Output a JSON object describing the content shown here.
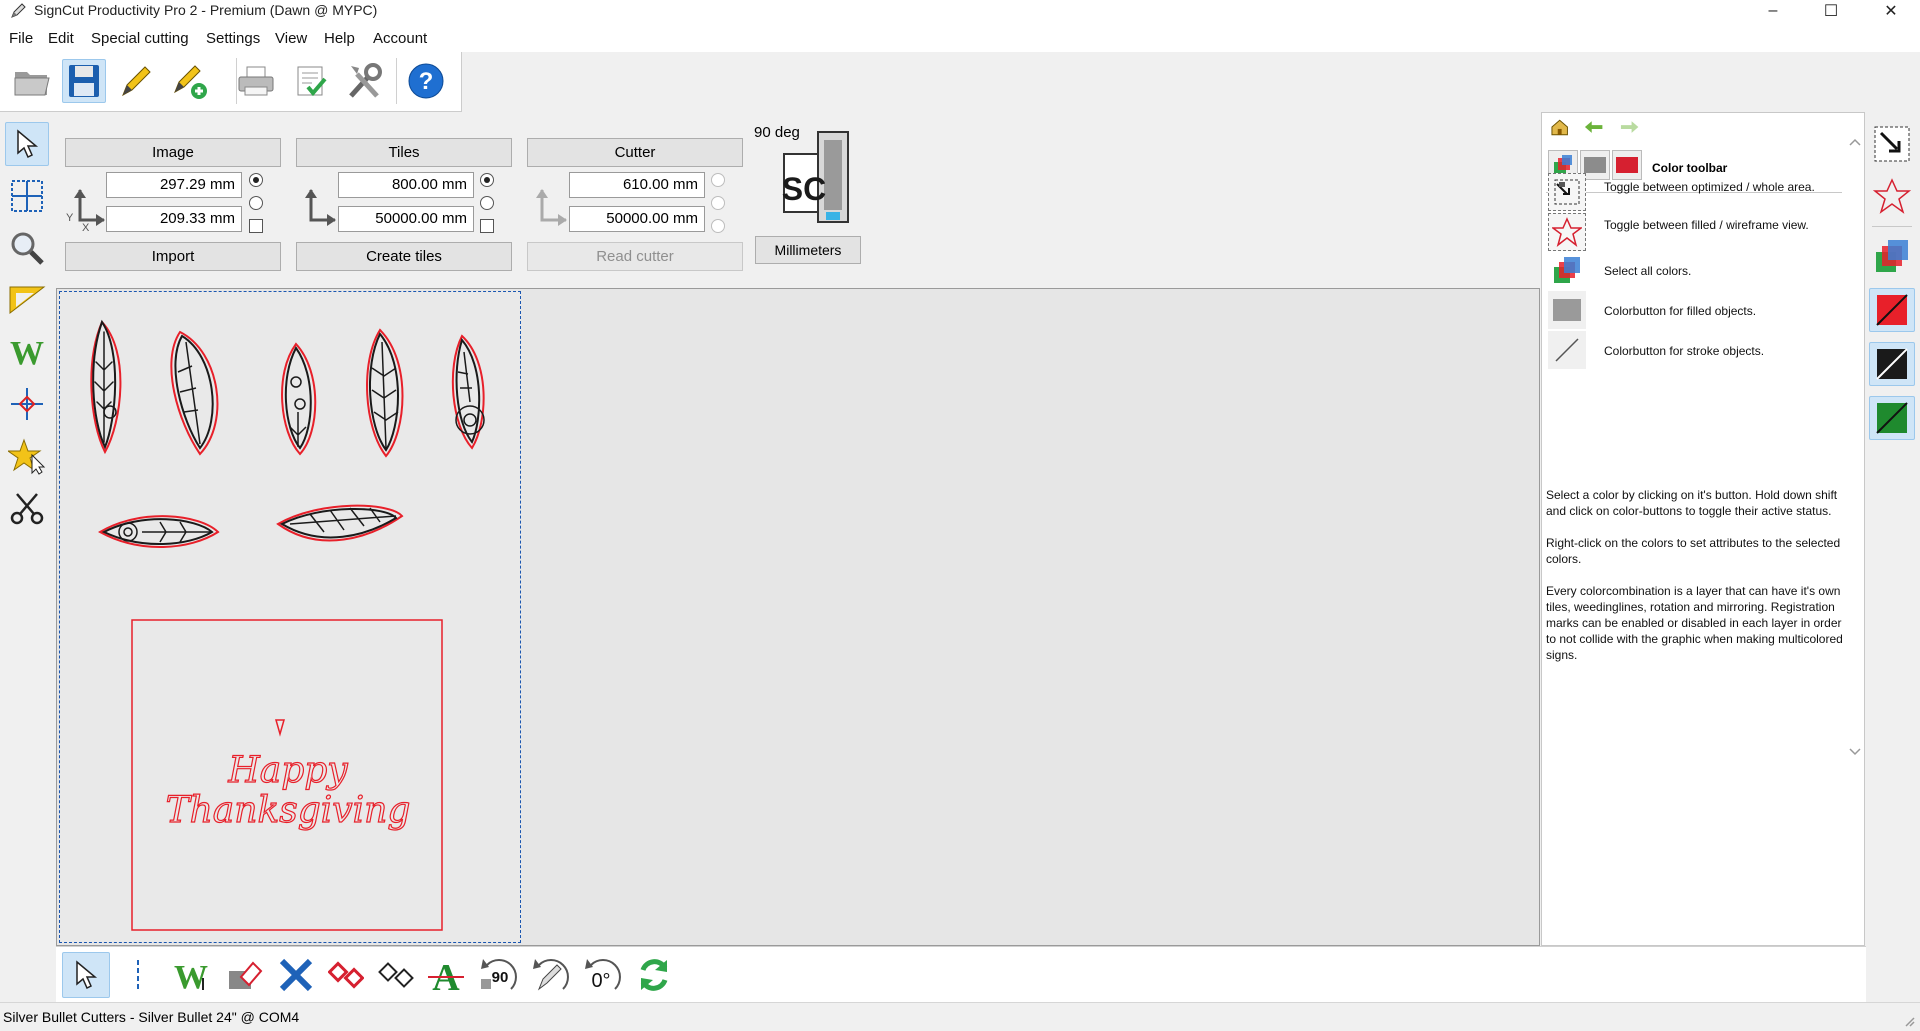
{
  "window": {
    "title": "SignCut Productivity Pro 2 - Premium (Dawn @ MYPC)",
    "minimize": "–",
    "maximize": "☐",
    "close": "✕"
  },
  "menu": [
    "File",
    "Edit",
    "Special cutting",
    "Settings",
    "View",
    "Help",
    "Account"
  ],
  "toolbar": [
    {
      "icon": "open-folder-icon"
    },
    {
      "icon": "save-icon"
    },
    {
      "icon": "pencil-edit-icon"
    },
    {
      "icon": "pencil-add-icon"
    },
    {
      "icon": "printer-icon"
    },
    {
      "icon": "checklist-icon"
    },
    {
      "icon": "tools-icon"
    },
    {
      "icon": "help-icon"
    }
  ],
  "params": {
    "image": {
      "label": "Image",
      "width": "297.29 mm",
      "height": "209.33 mm",
      "action": "Import"
    },
    "tiles": {
      "label": "Tiles",
      "width": "800.00 mm",
      "height": "50000.00 mm",
      "action": "Create tiles"
    },
    "cutter": {
      "label": "Cutter",
      "width": "610.00 mm",
      "height": "50000.00 mm",
      "action": "Read cutter"
    },
    "rotation": "90 deg",
    "units": "Millimeters",
    "axis_y": "Y",
    "axis_x": "X",
    "logo_text": "SC"
  },
  "canvas": {
    "card_text_line1": "Happy",
    "card_text_line2": "Thanksgiving",
    "accent": "#e8202a"
  },
  "help": {
    "title": "Color toolbar",
    "items": [
      {
        "icon": "optimized-area-icon",
        "text": "Toggle between optimized / whole area."
      },
      {
        "icon": "star-wireframe-icon",
        "text": "Toggle between filled / wireframe view."
      },
      {
        "icon": "select-all-colors-icon",
        "text": "Select all colors."
      },
      {
        "icon": "fill-color-icon",
        "text": "Colorbutton for filled objects."
      },
      {
        "icon": "stroke-color-icon",
        "text": "Colorbutton for stroke objects."
      }
    ],
    "paragraphs": [
      "Select a color by clicking on it's button. Hold down shift and click on color-buttons to toggle their active status.",
      "Right-click on the colors to set attributes to the selected colors.",
      "Every colorcombination is a layer that can have it's own tiles, weedinglines, rotation and mirroring. Registration marks can be enabled or disabled in each layer in order to not collide with the graphic when making multicolored signs."
    ]
  },
  "bottom_toolbar": {
    "rotate90": "90",
    "rotate0": "0°"
  },
  "status": "Silver Bullet Cutters - Silver Bullet 24\" @ COM4"
}
